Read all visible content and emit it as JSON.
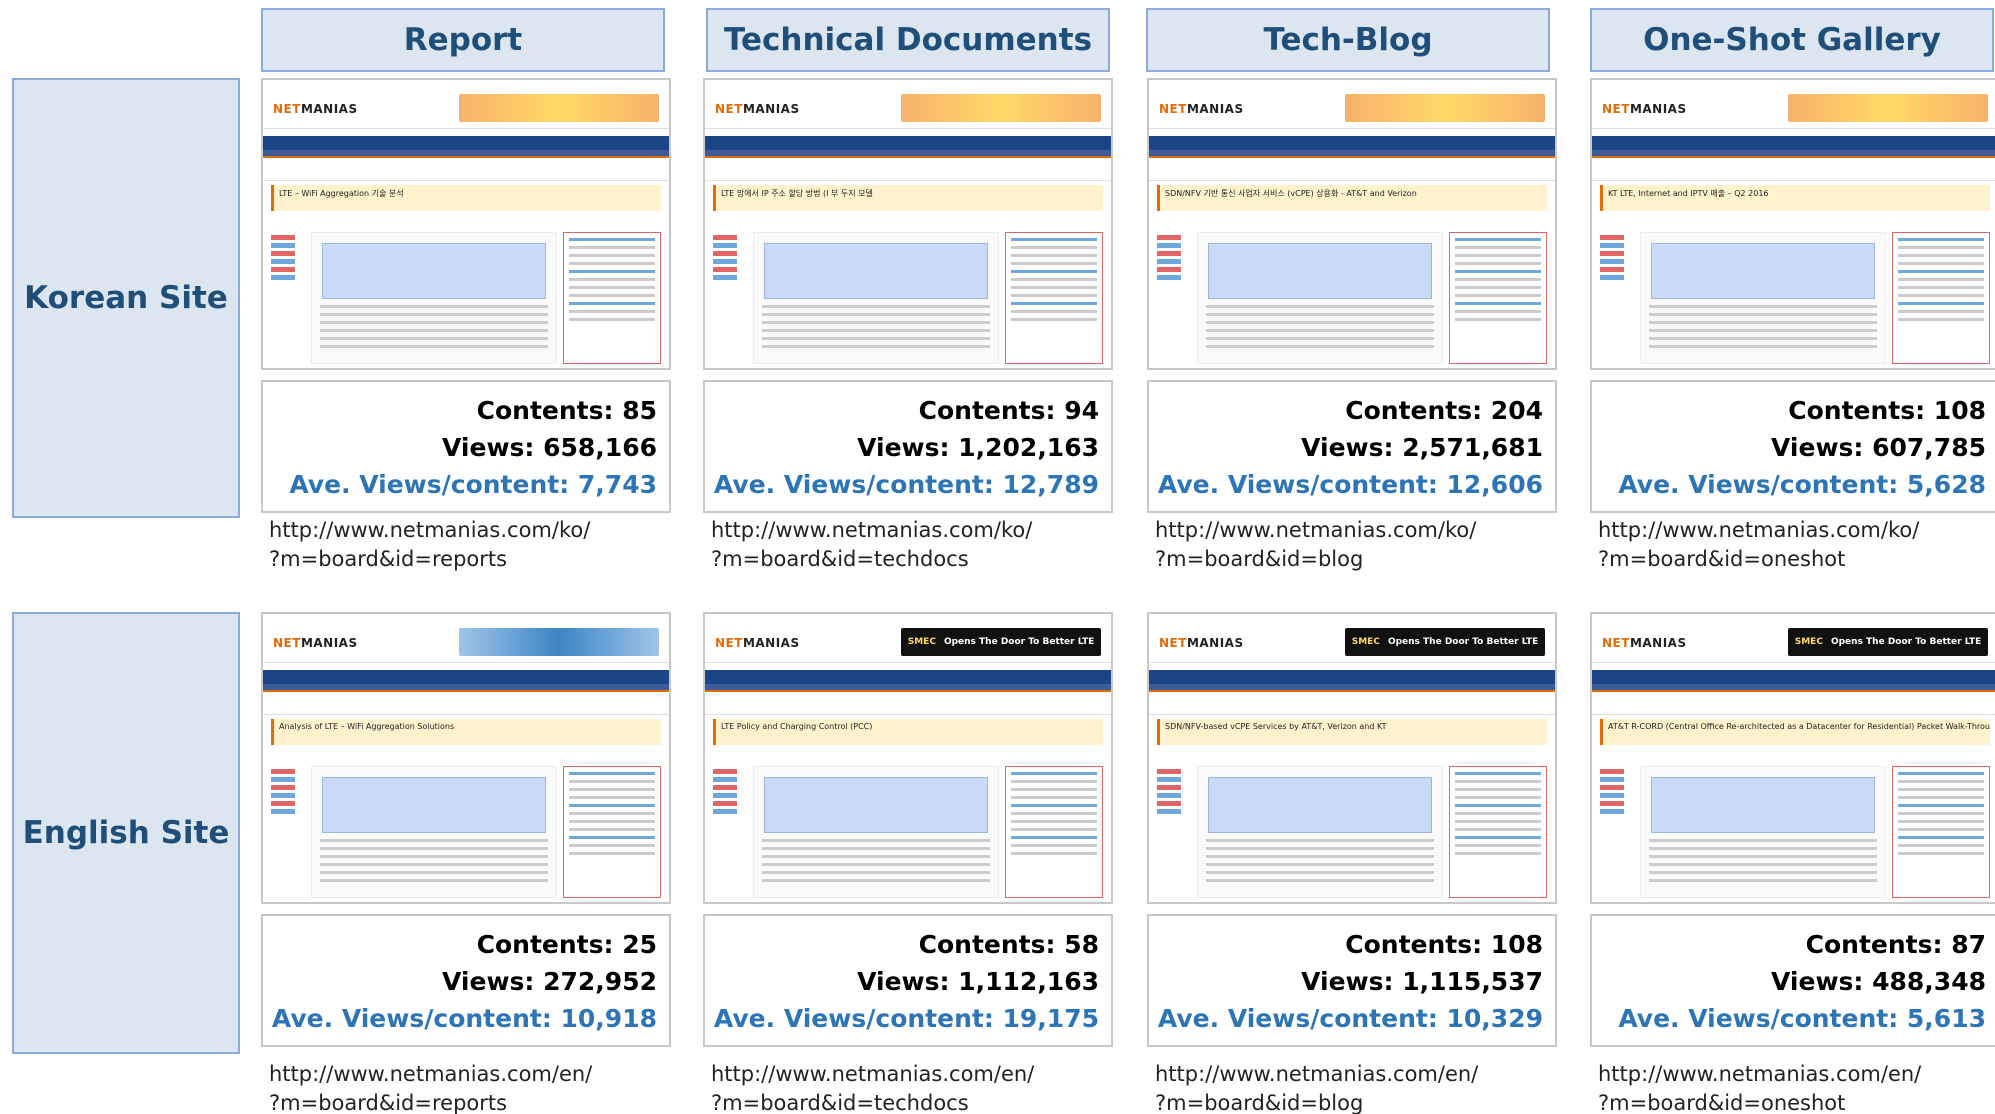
{
  "columns": [
    "Report",
    "Technical Documents",
    "Tech-Blog",
    "One-Shot Gallery"
  ],
  "rows": [
    {
      "label": "Korean Site",
      "cells": [
        {
          "contents": "Contents: 85",
          "views": "Views: 658,166",
          "avg": "Ave. Views/content: 7,743",
          "url1": "http://www.netmanias.com/ko/",
          "url2": "?m=board&id=reports",
          "thumb_title": "LTE – WiFi Aggregation 기술 분석"
        },
        {
          "contents": "Contents: 94",
          "views": "Views: 1,202,163",
          "avg": "Ave. Views/content: 12,789",
          "url1": "http://www.netmanias.com/ko/",
          "url2": "?m=board&id=techdocs",
          "thumb_title": "LTE 망에서 IP 주소 할당 방법 (I 부 두지 모델"
        },
        {
          "contents": "Contents: 204",
          "views": "Views: 2,571,681",
          "avg": "Ave. Views/content: 12,606",
          "url1": "http://www.netmanias.com/ko/",
          "url2": "?m=board&id=blog",
          "thumb_title": "SDN/NFV 기반 통신 사업자 서비스 (vCPE) 상용화 - AT&T and Verizon"
        },
        {
          "contents": "Contents: 108",
          "views": "Views: 607,785",
          "avg": "Ave. Views/content: 5,628",
          "url1": "http://www.netmanias.com/ko/",
          "url2": "?m=board&id=oneshot",
          "thumb_title": "KT LTE, Internet and IPTV 매출 – Q2 2016"
        }
      ]
    },
    {
      "label": "English Site",
      "cells": [
        {
          "contents": "Contents: 25",
          "views": "Views: 272,952",
          "avg": "Ave. Views/content: 10,918",
          "url1": "http://www.netmanias.com/en/",
          "url2": "?m=board&id=reports",
          "thumb_title": "Analysis of LTE – WiFi Aggregation Solutions"
        },
        {
          "contents": "Contents: 58",
          "views": "Views: 1,112,163",
          "avg": "Ave. Views/content: 19,175",
          "url1": "http://www.netmanias.com/en/",
          "url2": "?m=board&id=techdocs",
          "thumb_title": "LTE Policy and Charging Control (PCC)"
        },
        {
          "contents": "Contents: 108",
          "views": "Views: 1,115,537",
          "avg": "Ave. Views/content: 10,329",
          "url1": "http://www.netmanias.com/en/",
          "url2": "?m=board&id=blog",
          "thumb_title": "SDN/NFV-based vCPE Services by AT&T, Verizon and KT"
        },
        {
          "contents": "Contents: 87",
          "views": "Views: 488,348",
          "avg": "Ave. Views/content: 5,613",
          "url1": "http://www.netmanias.com/en/",
          "url2": "?m=board&id=oneshot",
          "thumb_title": "AT&T R-CORD (Central Office Re-architected as a Datacenter for Residential) Packet Walk-Through"
        }
      ]
    }
  ],
  "thumbnail": {
    "logo_a": "NET",
    "logo_b": "MANIAS",
    "banner_ko": "",
    "banner_en": "Opens The Door To Better LTE",
    "banner_brand": "SMEC"
  },
  "colors": {
    "header_fill": "#dce6f1",
    "header_border": "#8eaadb",
    "header_text": "#1f4e79",
    "avg_text": "#2e75b6"
  }
}
